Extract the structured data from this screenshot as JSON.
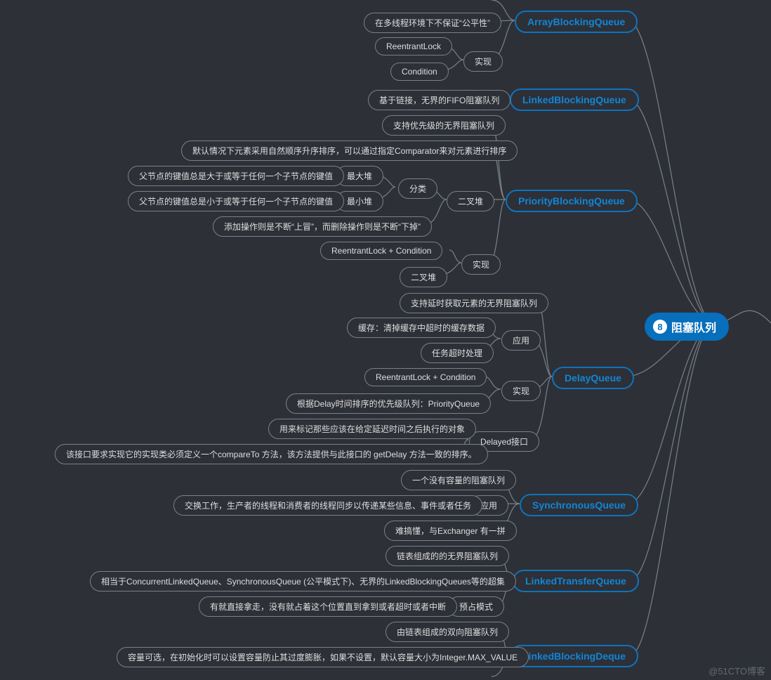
{
  "watermark": "@51CTO博客",
  "root": {
    "number": "8",
    "label": "阻塞队列"
  },
  "majors": {
    "arrayBQ": "ArrayBlockingQueue",
    "linkedBQ": "LinkedBlockingQueue",
    "priorityBQ": "PriorityBlockingQueue",
    "delayQ": "DelayQueue",
    "syncQ": "SynchronousQueue",
    "linkedTQ": "LinkedTransferQueue",
    "linkedBD": "LinkedBlockingDeque"
  },
  "nodes": {
    "abq_fair": "在多线程环境下不保证“公平性”",
    "abq_impl": "实现",
    "abq_reent": "ReentrantLock",
    "abq_cond": "Condition",
    "lbq_desc": "基于链接，无界的FIFO阻塞队列",
    "pbq_prio": "支持优先级的无界阻塞队列",
    "pbq_sort": "默认情况下元素采用自然顺序升序排序，可以通过指定Comparator来对元素进行排序",
    "pbq_heap": "二叉堆",
    "pbq_cls": "分类",
    "pbq_max": "最大堆",
    "pbq_min": "最小堆",
    "pbq_max_d": "父节点的键值总是大于或等于任何一个子节点的键值",
    "pbq_min_d": "父节点的键值总是小于或等于任何一个子节点的键值",
    "pbq_op": "添加操作则是不断“上冒”，而删除操作则是不断“下掉”",
    "pbq_impl": "实现",
    "pbq_reent": "ReentrantLock + Condition",
    "pbq_bheap": "二叉堆",
    "dq_delay": "支持延时获取元素的无界阻塞队列",
    "dq_app": "应用",
    "dq_cache": "缓存：清掉缓存中超时的缓存数据",
    "dq_task": "任务超时处理",
    "dq_impl": "实现",
    "dq_reent": "ReentrantLock + Condition",
    "dq_pq": "根据Delay时间排序的优先级队列：PriorityQueue",
    "dq_if": "Delayed接口",
    "dq_mark": "用来标记那些应该在给定延迟时间之后执行的对象",
    "dq_cmp": "该接口要求实现它的实现类必须定义一个compareTo 方法，该方法提供与此接口的 getDelay 方法一致的排序。",
    "sq_nocap": "一个没有容量的阻塞队列",
    "sq_app": "应用",
    "sq_exch": "交换工作，生产者的线程和消费者的线程同步以传递某些信息、事件或者任务",
    "sq_conf": "难搞懂，与Exchanger 有一拼",
    "ltq_link": "链表组成的的无界阻塞队列",
    "ltq_super": "相当于ConcurrentLinkedQueue、SynchronousQueue (公平模式下)、无界的LinkedBlockingQueues等的超集",
    "ltq_mode": "预占模式",
    "ltq_take": "有就直接拿走，没有就占着这个位置直到拿到或者超时或者中断",
    "lbd_bi": "由链表组成的双向阻塞队列",
    "lbd_cap": "容量可选，在初始化时可以设置容量防止其过度膨胀，如果不设置，默认容量大小为Integer.MAX_VALUE"
  }
}
